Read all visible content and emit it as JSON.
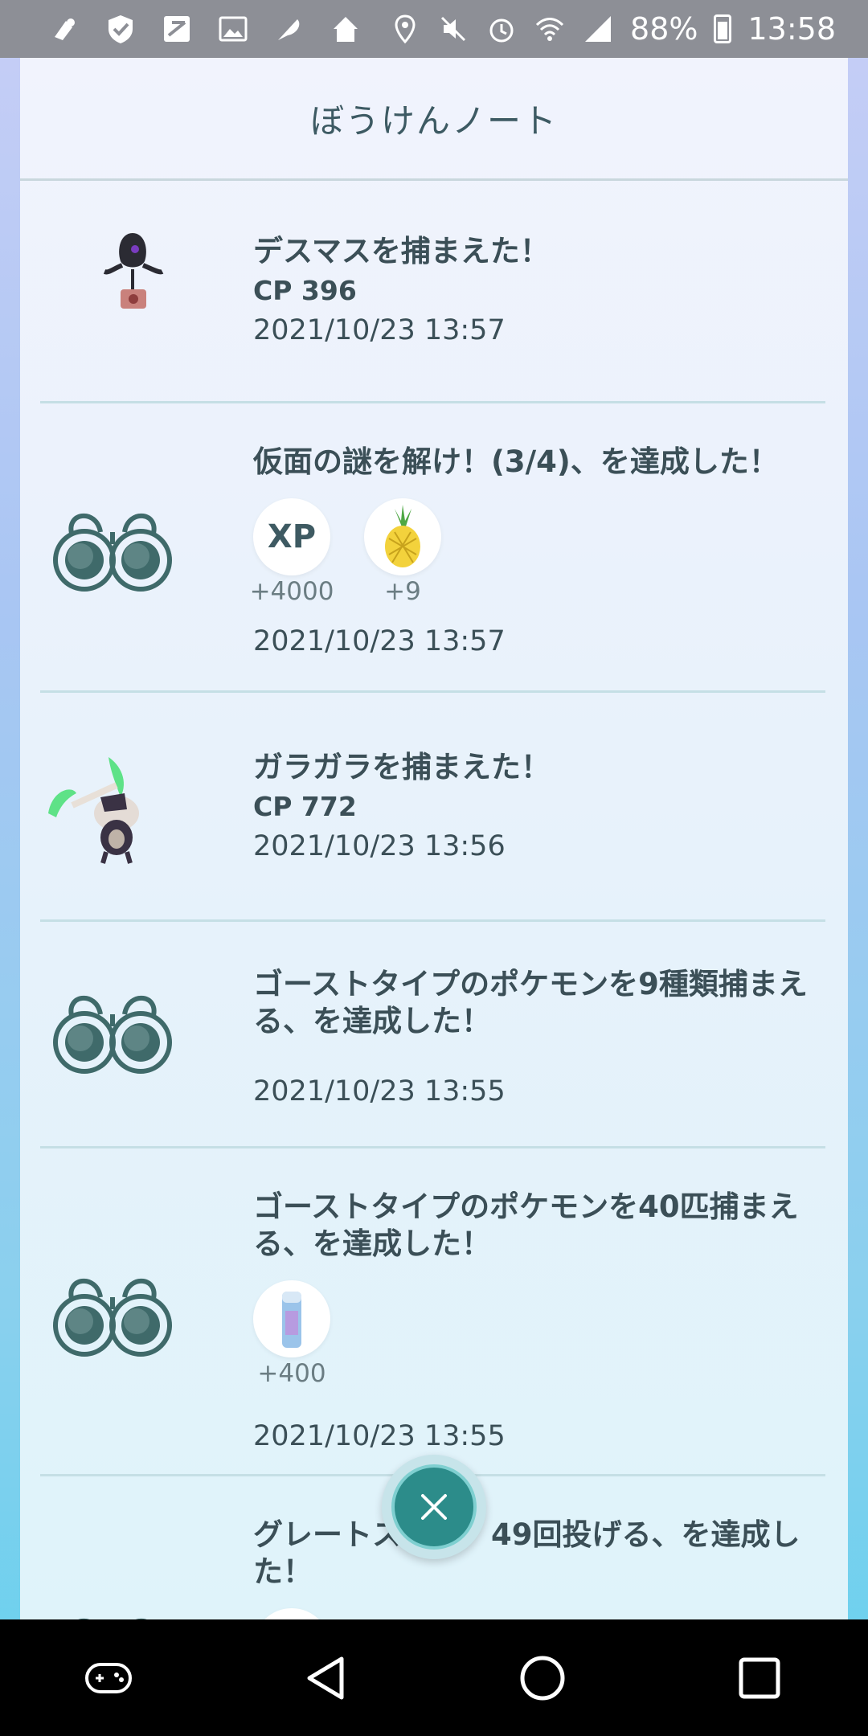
{
  "status_bar": {
    "battery": "88%",
    "time": "13:58",
    "left_icons": [
      "pokemon-go-plus-icon",
      "shield-check-icon",
      "app-icon",
      "gallery-icon",
      "feather-icon",
      "home-icon"
    ],
    "right_icons": [
      "location-icon",
      "mute-icon",
      "alarm-icon",
      "wifi-icon",
      "signal-icon",
      "battery-icon"
    ]
  },
  "panel": {
    "title": "ぼうけんノート"
  },
  "entries": [
    {
      "icon": "yamask-sprite",
      "title": "デスマスを捕まえた！",
      "cp": "CP 396",
      "date": "2021/10/23 13:57"
    },
    {
      "icon": "binoculars-icon",
      "title": "仮面の謎を解け！(3/4)、を達成した！",
      "rewards": [
        {
          "label": "XP",
          "amount": "+4000",
          "icon": "xp-icon"
        },
        {
          "label": "",
          "amount": "+9",
          "icon": "pinap-berry-icon"
        }
      ],
      "date": "2021/10/23 13:57"
    },
    {
      "icon": "marowak-sprite",
      "title": "ガラガラを捕まえた！",
      "cp": "CP 772",
      "date": "2021/10/23 13:56"
    },
    {
      "icon": "binoculars-icon",
      "title": "ゴーストタイプのポケモンを9種類捕まえる、を達成した！",
      "date": "2021/10/23 13:55"
    },
    {
      "icon": "binoculars-icon",
      "title": "ゴーストタイプのポケモンを40匹捕まえる、を達成した！",
      "rewards": [
        {
          "label": "",
          "amount": "+400",
          "icon": "stardust-icon"
        }
      ],
      "date": "2021/10/23 13:55"
    },
    {
      "icon": "binoculars-icon",
      "title": "グレートス　　　49回投げる、を達成した！"
    }
  ],
  "colors": {
    "accent": "#2c8c8a",
    "text": "#3b4f57"
  }
}
